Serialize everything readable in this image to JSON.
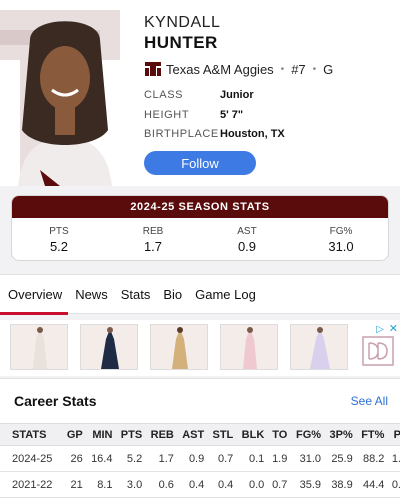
{
  "player": {
    "first_name": "KYNDALL",
    "last_name": "HUNTER",
    "team": "Texas A&M Aggies",
    "number": "#7",
    "position": "G",
    "info": [
      {
        "label": "CLASS",
        "value": "Junior"
      },
      {
        "label": "HEIGHT",
        "value": "5' 7\""
      },
      {
        "label": "BIRTHPLACE",
        "value": "Houston, TX"
      }
    ],
    "follow_label": "Follow"
  },
  "season_stats": {
    "title": "2024-25 SEASON STATS",
    "items": [
      {
        "label": "PTS",
        "value": "5.2"
      },
      {
        "label": "REB",
        "value": "1.7"
      },
      {
        "label": "AST",
        "value": "0.9"
      },
      {
        "label": "FG%",
        "value": "31.0"
      }
    ]
  },
  "tabs": [
    "Overview",
    "News",
    "Stats",
    "Bio",
    "Game Log"
  ],
  "ad": {
    "badge": "▷",
    "close": "✕"
  },
  "career": {
    "title": "Career Stats",
    "see_all": "See All",
    "columns": [
      "STATS",
      "GP",
      "MIN",
      "PTS",
      "REB",
      "AST",
      "STL",
      "BLK",
      "TO",
      "FG%",
      "3P%",
      "FT%",
      "P"
    ],
    "rows": [
      [
        "2024-25",
        "26",
        "16.4",
        "5.2",
        "1.7",
        "0.9",
        "0.7",
        "0.1",
        "1.9",
        "31.0",
        "25.9",
        "88.2",
        "1."
      ],
      [
        "2021-22",
        "21",
        "8.1",
        "3.0",
        "0.6",
        "0.4",
        "0.4",
        "0.0",
        "0.7",
        "35.9",
        "38.9",
        "44.4",
        "0."
      ]
    ]
  },
  "colors": {
    "brand_maroon": "#5a0b0c",
    "follow_blue": "#3d7ae3",
    "tab_underline": "#c8102e",
    "link_blue": "#2f6fd6"
  }
}
